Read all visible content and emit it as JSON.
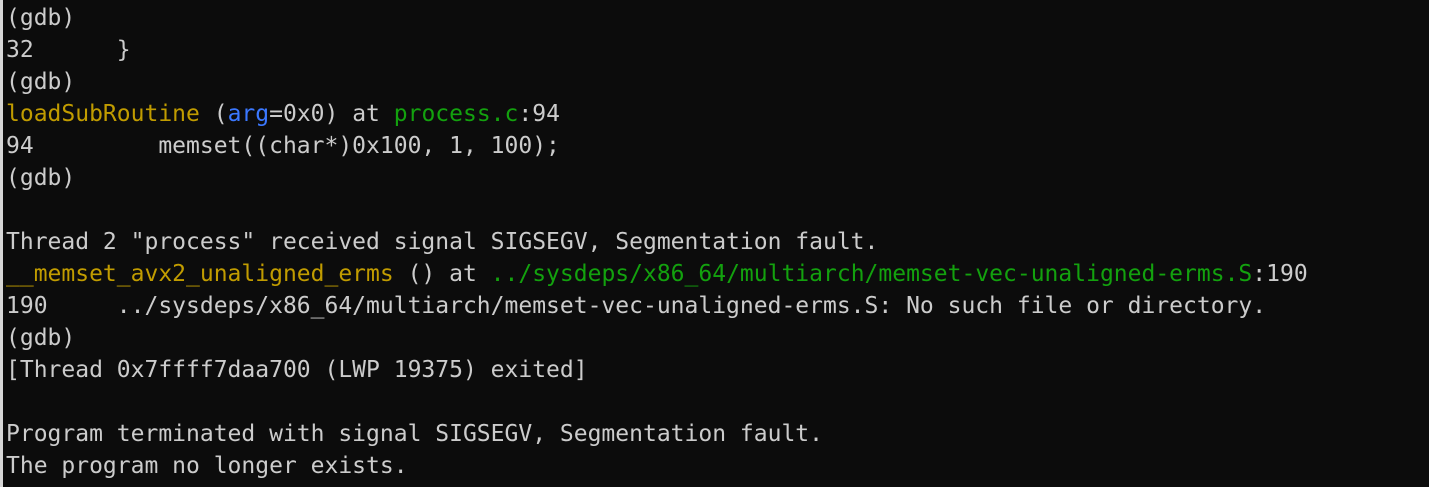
{
  "colors": {
    "background": "#0c0c0c",
    "text": "#cccccc",
    "function_name": "#c19c00",
    "argument_name": "#3b78ff",
    "file_path": "#13a10e"
  },
  "lines": [
    {
      "kind": "prompt",
      "text": "(gdb)"
    },
    {
      "kind": "source",
      "text": "32      }"
    },
    {
      "kind": "prompt",
      "text": "(gdb)"
    },
    {
      "kind": "frame",
      "func": "loadSubRoutine",
      "pre_arg": " (",
      "arg_name": "arg",
      "arg_rest": "=0x0) at ",
      "file": "process.c",
      "suffix": ":94"
    },
    {
      "kind": "source",
      "text": "94         memset((char*)0x100, 1, 100);"
    },
    {
      "kind": "prompt",
      "text": "(gdb)"
    },
    {
      "kind": "blank",
      "text": ""
    },
    {
      "kind": "message",
      "text": "Thread 2 \"process\" received signal SIGSEGV, Segmentation fault."
    },
    {
      "kind": "frame2",
      "func": "__memset_avx2_unaligned_erms",
      "mid": " () at ",
      "file": "../sysdeps/x86_64/multiarch/memset-vec-unaligned-erms.S",
      "suffix": ":190"
    },
    {
      "kind": "source",
      "text": "190     ../sysdeps/x86_64/multiarch/memset-vec-unaligned-erms.S: No such file or directory."
    },
    {
      "kind": "prompt",
      "text": "(gdb)"
    },
    {
      "kind": "message",
      "text": "[Thread 0x7ffff7daa700 (LWP 19375) exited]"
    },
    {
      "kind": "blank",
      "text": ""
    },
    {
      "kind": "message",
      "text": "Program terminated with signal SIGSEGV, Segmentation fault."
    },
    {
      "kind": "message",
      "text": "The program no longer exists."
    }
  ]
}
